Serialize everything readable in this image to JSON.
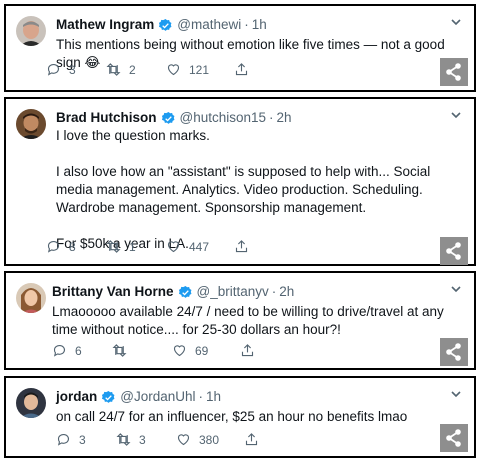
{
  "tweets": [
    {
      "name": "Mathew Ingram",
      "handle": "@mathewi",
      "separator": "·",
      "time": "1h",
      "text": "This mentions being without emotion like five times — not a good sign 😂",
      "replies": "3",
      "retweets": "2",
      "likes": "121"
    },
    {
      "name": "Brad Hutchison",
      "handle": "@hutchison15",
      "separator": "·",
      "time": "2h",
      "text": "I love the question marks.\n\nI also love how an \"assistant\" is supposed to help with... Social media management. Analytics. Video production. Scheduling. Wardrobe management. Sponsorship management.\n\nFor $50k a year in LA.",
      "replies": "8",
      "retweets": "1",
      "likes": "447"
    },
    {
      "name": "Brittany Van Horne",
      "handle": "@_brittanyv",
      "separator": "·",
      "time": "2h",
      "text": "Lmaooooo available 24/7 / need to be willing to drive/travel at any time without notice.... for 25-30 dollars an hour?!",
      "replies": "6",
      "retweets": "",
      "likes": "69"
    },
    {
      "name": "jordan",
      "handle": "@JordanUhl",
      "separator": "·",
      "time": "1h",
      "text": "on call 24/7 for an influencer, $25 an hour no benefits lmao",
      "replies": "3",
      "retweets": "3",
      "likes": "380"
    }
  ],
  "icons": {
    "verified": "verified-badge-icon",
    "more": "chevron-down-icon",
    "reply": "reply-icon",
    "retweet": "retweet-icon",
    "like": "heart-icon",
    "share": "share-icon",
    "share_overlay": "share-network-icon"
  },
  "colors": {
    "verified": "#1d9bf0",
    "text": "#0f1419",
    "muted": "#536471",
    "share_overlay_bg": "#8e8e8e"
  }
}
